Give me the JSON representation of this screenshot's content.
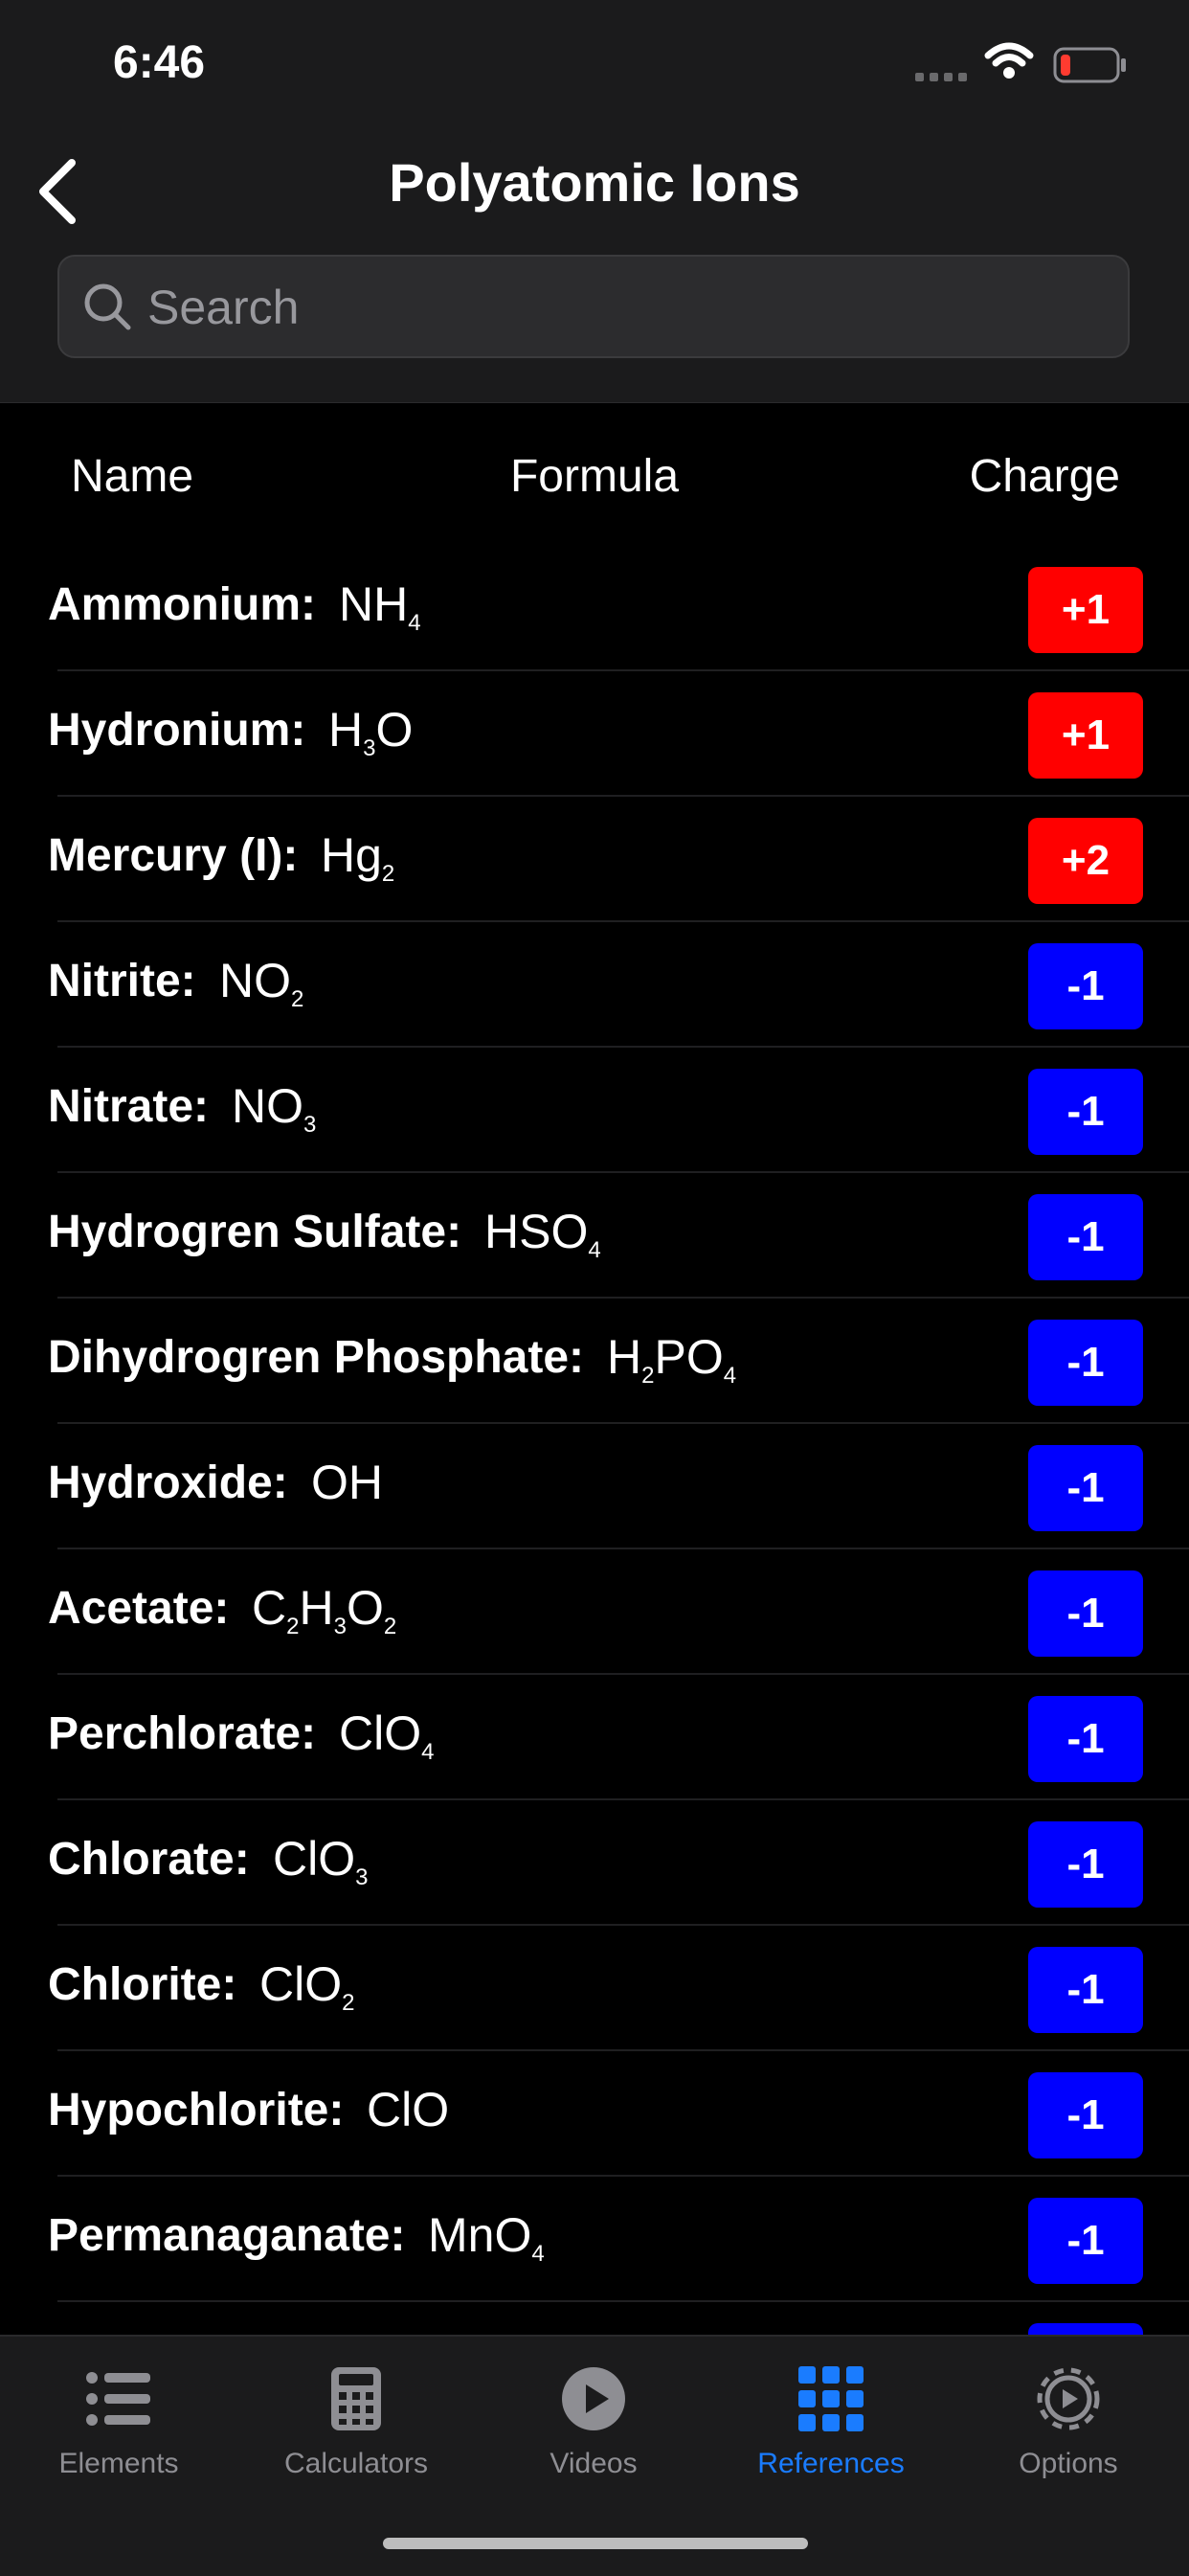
{
  "status": {
    "time": "6:46"
  },
  "nav": {
    "title": "Polyatomic Ions"
  },
  "search": {
    "placeholder": "Search"
  },
  "columns": {
    "name": "Name",
    "formula": "Formula",
    "charge": "Charge"
  },
  "colors": {
    "positive": "#ff0000",
    "negative": "#0000ff",
    "accent": "#1a7cff"
  },
  "ions": [
    {
      "name": "Ammonium:",
      "formula": [
        [
          "NH",
          ""
        ],
        [
          "",
          "4"
        ]
      ],
      "charge": "+1",
      "sign": "positive"
    },
    {
      "name": "Hydronium:",
      "formula": [
        [
          "H",
          ""
        ],
        [
          "",
          "3"
        ],
        [
          "O",
          ""
        ]
      ],
      "charge": "+1",
      "sign": "positive"
    },
    {
      "name": "Mercury (I):",
      "formula": [
        [
          "Hg",
          ""
        ],
        [
          "",
          "2"
        ]
      ],
      "charge": "+2",
      "sign": "positive"
    },
    {
      "name": "Nitrite:",
      "formula": [
        [
          "NO",
          ""
        ],
        [
          "",
          "2"
        ]
      ],
      "charge": "-1",
      "sign": "negative"
    },
    {
      "name": "Nitrate:",
      "formula": [
        [
          "NO",
          ""
        ],
        [
          "",
          "3"
        ]
      ],
      "charge": "-1",
      "sign": "negative"
    },
    {
      "name": "Hydrogren Sulfate:",
      "formula": [
        [
          "HSO",
          ""
        ],
        [
          "",
          "4"
        ]
      ],
      "charge": "-1",
      "sign": "negative"
    },
    {
      "name": "Dihydrogren Phosphate:",
      "formula": [
        [
          "H",
          ""
        ],
        [
          "",
          "2"
        ],
        [
          "PO",
          ""
        ],
        [
          "",
          "4"
        ]
      ],
      "charge": "-1",
      "sign": "negative"
    },
    {
      "name": "Hydroxide:",
      "formula": [
        [
          "OH",
          ""
        ]
      ],
      "charge": "-1",
      "sign": "negative"
    },
    {
      "name": "Acetate:",
      "formula": [
        [
          "C",
          ""
        ],
        [
          "",
          "2"
        ],
        [
          "H",
          ""
        ],
        [
          "",
          "3"
        ],
        [
          "O",
          ""
        ],
        [
          "",
          "2"
        ]
      ],
      "charge": "-1",
      "sign": "negative"
    },
    {
      "name": "Perchlorate:",
      "formula": [
        [
          "ClO",
          ""
        ],
        [
          "",
          "4"
        ]
      ],
      "charge": "-1",
      "sign": "negative"
    },
    {
      "name": "Chlorate:",
      "formula": [
        [
          "ClO",
          ""
        ],
        [
          "",
          "3"
        ]
      ],
      "charge": "-1",
      "sign": "negative"
    },
    {
      "name": "Chlorite:",
      "formula": [
        [
          "ClO",
          ""
        ],
        [
          "",
          "2"
        ]
      ],
      "charge": "-1",
      "sign": "negative"
    },
    {
      "name": "Hypochlorite:",
      "formula": [
        [
          "ClO",
          ""
        ]
      ],
      "charge": "-1",
      "sign": "negative"
    },
    {
      "name": "Permanaganate:",
      "formula": [
        [
          "MnO",
          ""
        ],
        [
          "",
          "4"
        ]
      ],
      "charge": "-1",
      "sign": "negative"
    },
    {
      "name": "",
      "formula": [],
      "charge": "",
      "sign": "negative"
    }
  ],
  "tabs": [
    {
      "label": "Elements",
      "icon": "list-icon",
      "active": false
    },
    {
      "label": "Calculators",
      "icon": "calculator-icon",
      "active": false
    },
    {
      "label": "Videos",
      "icon": "play-icon",
      "active": false
    },
    {
      "label": "References",
      "icon": "grid-icon",
      "active": true
    },
    {
      "label": "Options",
      "icon": "gear-icon",
      "active": false
    }
  ]
}
